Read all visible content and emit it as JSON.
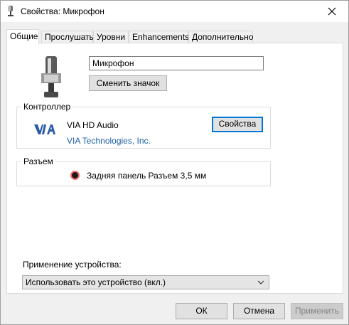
{
  "window": {
    "title": "Свойства: Микрофон"
  },
  "tabs": [
    {
      "label": "Общие"
    },
    {
      "label": "Прослушать"
    },
    {
      "label": "Уровни"
    },
    {
      "label": "Enhancements"
    },
    {
      "label": "Дополнительно"
    }
  ],
  "general": {
    "device_name": "Микрофон",
    "change_icon_label": "Сменить значок",
    "controller": {
      "group_label": "Контроллер",
      "name": "VIA HD Audio",
      "vendor": "VIA Technologies, Inc.",
      "properties_label": "Свойства",
      "logo_text": "VIA"
    },
    "jack": {
      "group_label": "Разъем",
      "info": "Задняя панель Разъем 3,5 мм"
    },
    "usage": {
      "label": "Применение устройства:",
      "selected": "Использовать это устройство (вкл.)"
    }
  },
  "footer": {
    "ok_label": "ОК",
    "cancel_label": "Отмена",
    "apply_label": "Применить"
  },
  "colors": {
    "accent": "#0078d7",
    "vendor_link": "#1c5fa8",
    "jack_ring": "#ff6b6b"
  }
}
